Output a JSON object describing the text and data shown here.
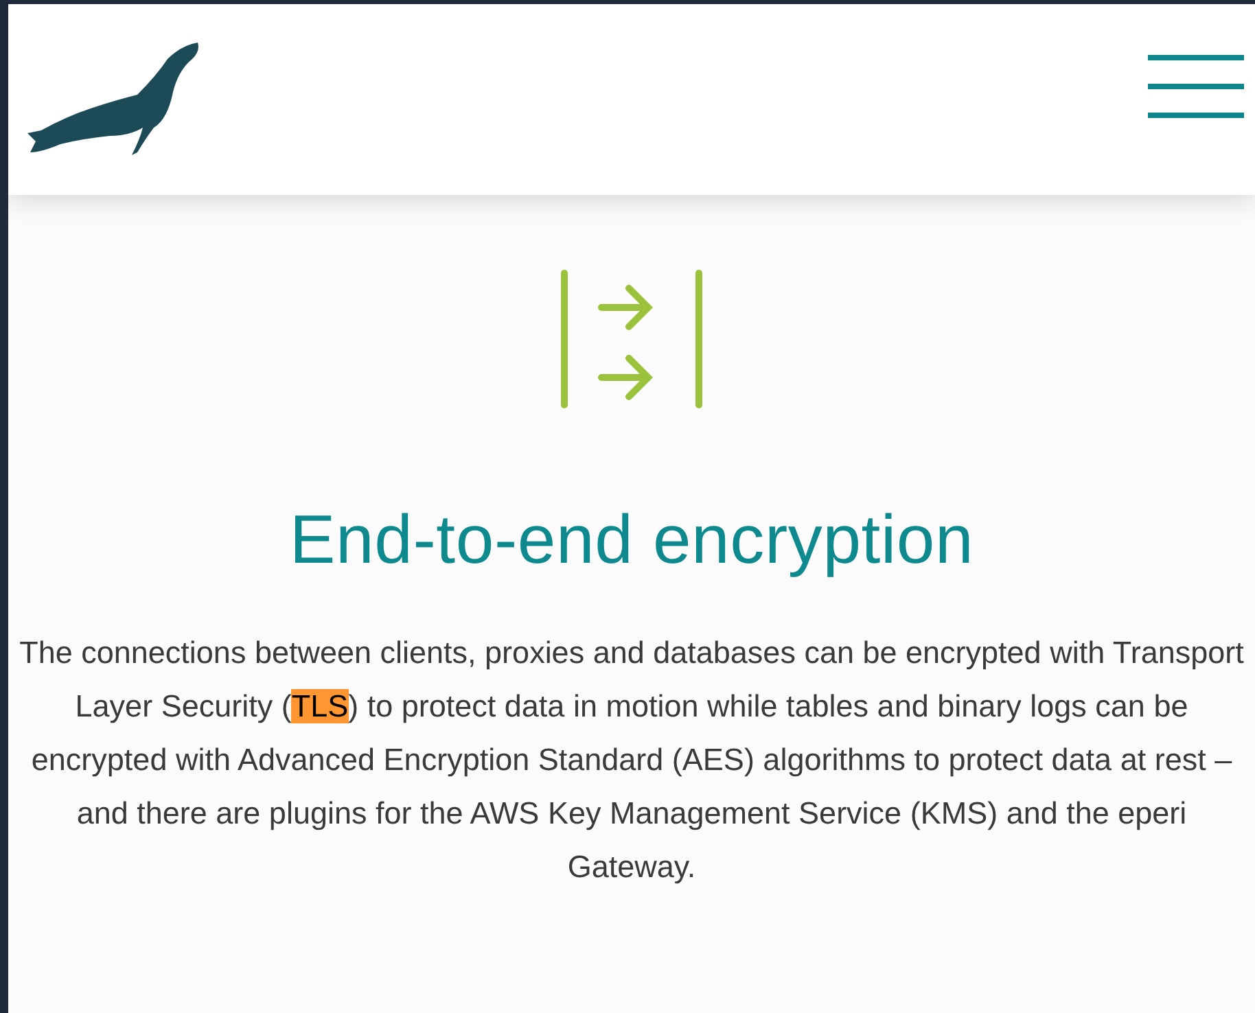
{
  "header": {
    "menu_open": false
  },
  "feature": {
    "title": "End-to-end encryption",
    "description": [
      {
        "text": "The connections between clients, proxies and databases can be encrypted with Transport Layer Security (",
        "highlighted": false
      },
      {
        "text": "TLS",
        "highlighted": true
      },
      {
        "text": ") to protect data in motion while tables and binary logs can be encrypted with Advanced Encryption Standard (AES) algorithms to protect data at rest – and there are plugins for the AWS Key Management Service (KMS) and the eperi Gateway.",
        "highlighted": false
      }
    ]
  }
}
